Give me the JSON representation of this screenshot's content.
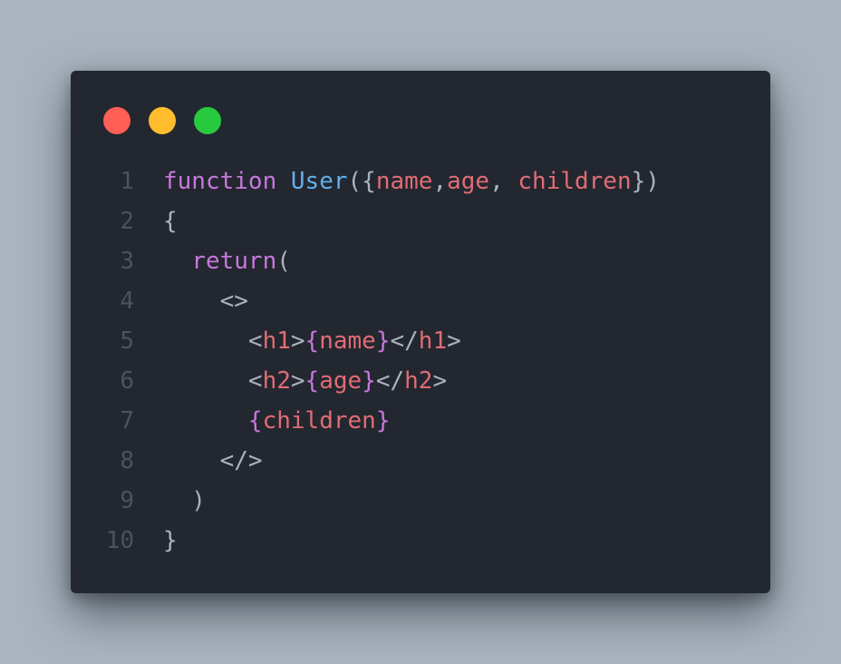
{
  "window": {
    "dots": [
      {
        "name": "close",
        "color": "#ff5f56"
      },
      {
        "name": "minimize",
        "color": "#ffbd2e"
      },
      {
        "name": "maximize",
        "color": "#27c93f"
      }
    ]
  },
  "code": {
    "lines": [
      {
        "number": "1",
        "tokens": [
          {
            "text": "function",
            "kind": "keyword"
          },
          {
            "text": " ",
            "kind": "punct"
          },
          {
            "text": "User",
            "kind": "func"
          },
          {
            "text": "({",
            "kind": "punct"
          },
          {
            "text": "name",
            "kind": "param"
          },
          {
            "text": ",",
            "kind": "punct"
          },
          {
            "text": "age",
            "kind": "param"
          },
          {
            "text": ", ",
            "kind": "punct"
          },
          {
            "text": "children",
            "kind": "param"
          },
          {
            "text": "})",
            "kind": "punct"
          }
        ]
      },
      {
        "number": "2",
        "tokens": [
          {
            "text": "{",
            "kind": "punct"
          }
        ]
      },
      {
        "number": "3",
        "tokens": [
          {
            "text": "  ",
            "kind": "punct"
          },
          {
            "text": "return",
            "kind": "keyword"
          },
          {
            "text": "(",
            "kind": "punct"
          }
        ]
      },
      {
        "number": "4",
        "tokens": [
          {
            "text": "    <>",
            "kind": "punct"
          }
        ]
      },
      {
        "number": "5",
        "tokens": [
          {
            "text": "      <",
            "kind": "punct"
          },
          {
            "text": "h1",
            "kind": "tag"
          },
          {
            "text": ">",
            "kind": "punct"
          },
          {
            "text": "{",
            "kind": "brace"
          },
          {
            "text": "name",
            "kind": "param"
          },
          {
            "text": "}",
            "kind": "brace"
          },
          {
            "text": "</",
            "kind": "punct"
          },
          {
            "text": "h1",
            "kind": "tag"
          },
          {
            "text": ">",
            "kind": "punct"
          }
        ]
      },
      {
        "number": "6",
        "tokens": [
          {
            "text": "      <",
            "kind": "punct"
          },
          {
            "text": "h2",
            "kind": "tag"
          },
          {
            "text": ">",
            "kind": "punct"
          },
          {
            "text": "{",
            "kind": "brace"
          },
          {
            "text": "age",
            "kind": "param"
          },
          {
            "text": "}",
            "kind": "brace"
          },
          {
            "text": "</",
            "kind": "punct"
          },
          {
            "text": "h2",
            "kind": "tag"
          },
          {
            "text": ">",
            "kind": "punct"
          }
        ]
      },
      {
        "number": "7",
        "tokens": [
          {
            "text": "      ",
            "kind": "punct"
          },
          {
            "text": "{",
            "kind": "brace"
          },
          {
            "text": "children",
            "kind": "param"
          },
          {
            "text": "}",
            "kind": "brace"
          }
        ]
      },
      {
        "number": "8",
        "tokens": [
          {
            "text": "    </>",
            "kind": "punct"
          }
        ]
      },
      {
        "number": "9",
        "tokens": [
          {
            "text": "  )",
            "kind": "punct"
          }
        ]
      },
      {
        "number": "10",
        "tokens": [
          {
            "text": "}",
            "kind": "punct"
          }
        ]
      }
    ]
  }
}
